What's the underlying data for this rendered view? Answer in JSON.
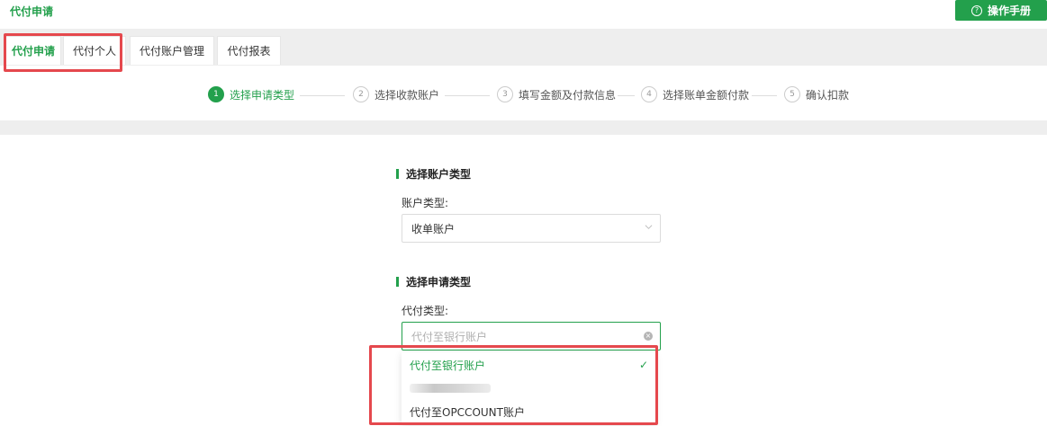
{
  "header": {
    "title": "代付申请",
    "manual_button": "操作手册",
    "manual_icon": "question-circle-icon"
  },
  "tabs": [
    {
      "label": "代付申请",
      "active": true
    },
    {
      "label": "代付个人",
      "active": false
    },
    {
      "label": "代付账户管理",
      "active": false
    },
    {
      "label": "代付报表",
      "active": false
    }
  ],
  "steps": [
    {
      "num": "1",
      "label": "选择申请类型",
      "active": true
    },
    {
      "num": "2",
      "label": "选择收款账户",
      "active": false
    },
    {
      "num": "3",
      "label": "填写金额及付款信息",
      "active": false
    },
    {
      "num": "4",
      "label": "选择账单金额付款",
      "active": false
    },
    {
      "num": "5",
      "label": "确认扣款",
      "active": false
    }
  ],
  "account_section": {
    "title": "选择账户类型",
    "label": "账户类型:",
    "value": "收单账户"
  },
  "apply_section": {
    "title": "选择申请类型",
    "label": "代付类型:",
    "placeholder": "代付至银行账户",
    "options": [
      {
        "label": "代付至银行账户",
        "selected": true
      },
      {
        "label": "",
        "selected": false
      },
      {
        "label": "代付至OPCCOUNT账户",
        "selected": false
      }
    ]
  },
  "colors": {
    "accent": "#23a04c",
    "highlight": "#e5484d"
  }
}
